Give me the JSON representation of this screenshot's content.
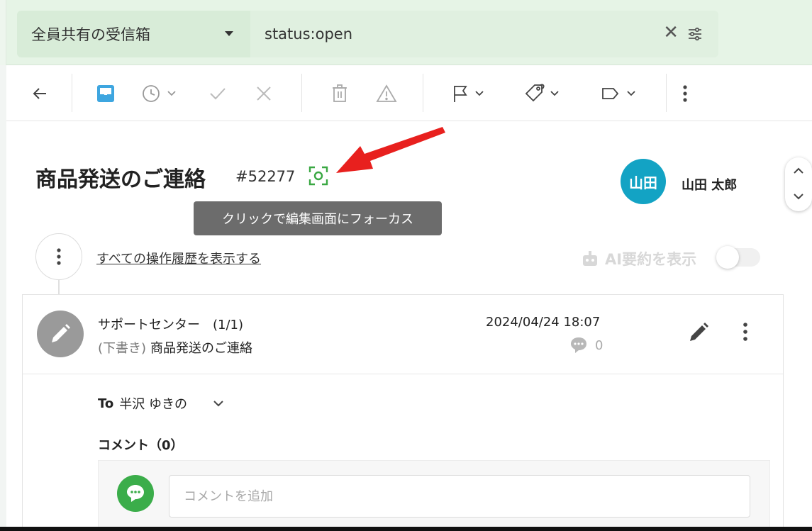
{
  "search": {
    "mailbox": "全員共有の受信箱",
    "query": "status:open"
  },
  "toolbar": {
    "icons": [
      "back-arrow-icon",
      "inbox-icon",
      "snooze-clock-icon",
      "check-icon",
      "close-icon",
      "trash-icon",
      "warning-icon",
      "flag-icon",
      "tag-icon",
      "label-icon",
      "more-vertical-icon"
    ]
  },
  "ticket": {
    "subject": "商品発送のご連絡",
    "number": "#52277"
  },
  "tooltip": {
    "text": "クリックで編集画面にフォーカス"
  },
  "assignee": {
    "initials": "山田",
    "name": "山田 太郎"
  },
  "history": {
    "link": "すべての操作履歴を表示する",
    "ai_summary": "AI要約を表示",
    "ai_enabled": false
  },
  "message": {
    "sender": "サポートセンター　(1/1)",
    "draft_tag": "(下書き)",
    "subject": "商品発送のご連絡",
    "date": "2024/04/24 18:07",
    "comment_count": "0",
    "to_label": "To",
    "to_name": "半沢 ゆきの"
  },
  "comments": {
    "label": "コメント（0）",
    "placeholder": "コメントを追加"
  }
}
